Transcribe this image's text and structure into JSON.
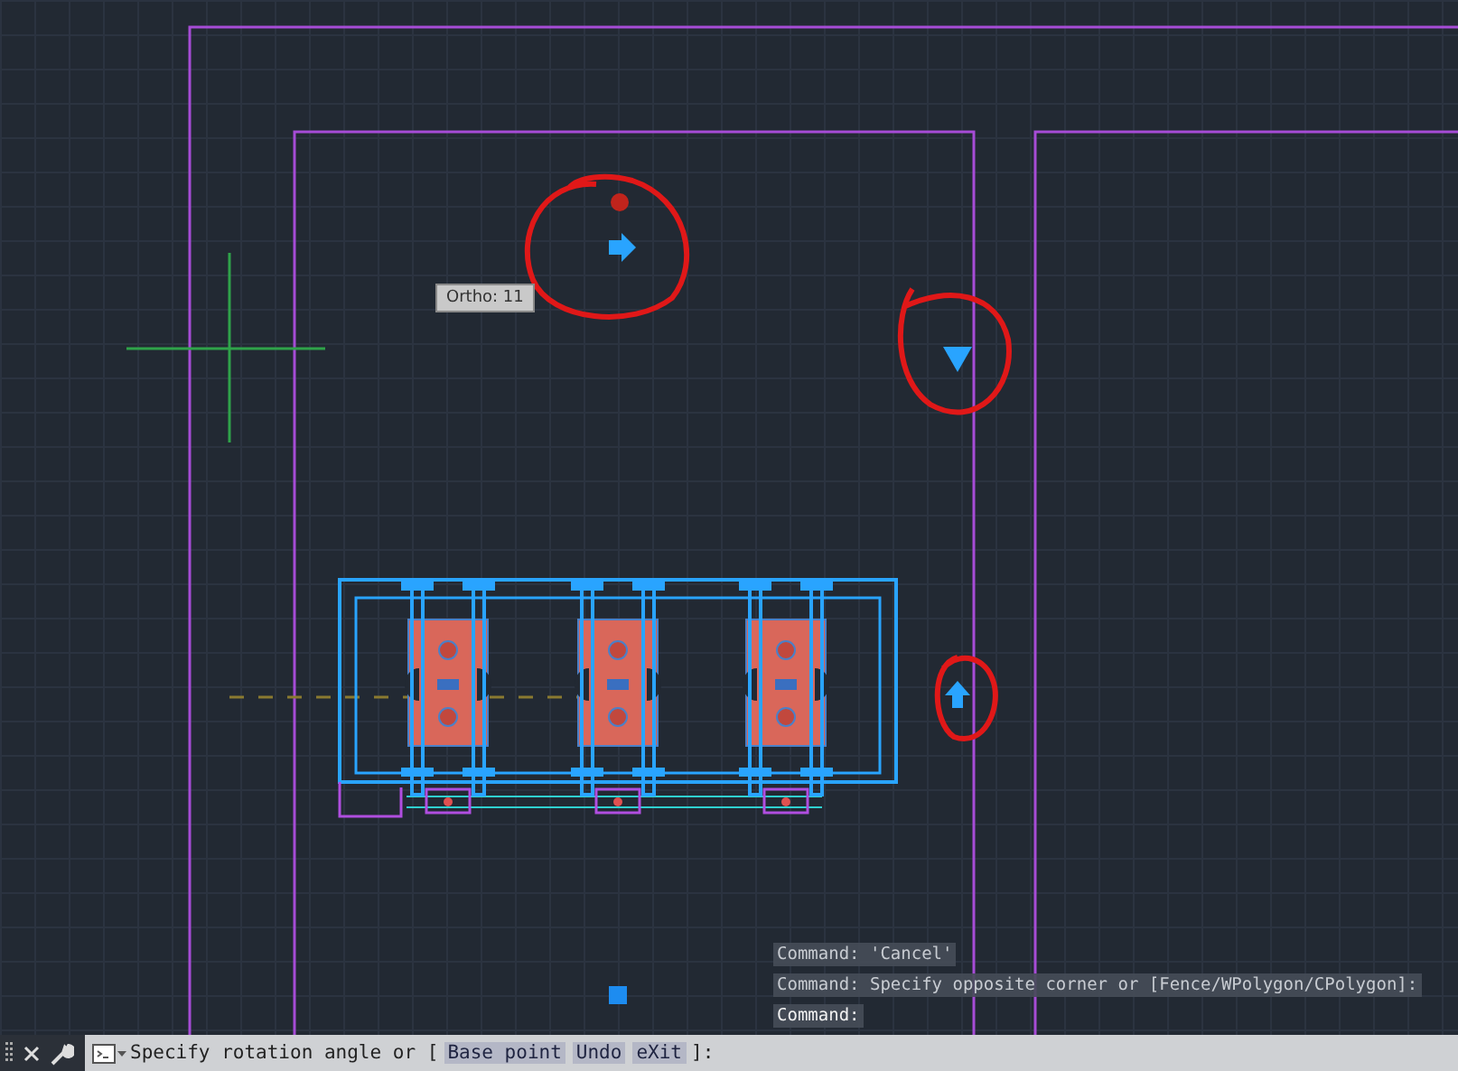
{
  "drawing_area": {
    "tooltip": "Ortho: 11"
  },
  "command_history": [
    "Command: 'Cancel'",
    "Command: Specify opposite corner or [Fence/WPolygon/CPolygon]:",
    "Command:"
  ],
  "command_line": {
    "prompt": "Specify rotation angle or [",
    "options": [
      "Base point",
      "Undo",
      "eXit"
    ],
    "suffix": "]:"
  }
}
